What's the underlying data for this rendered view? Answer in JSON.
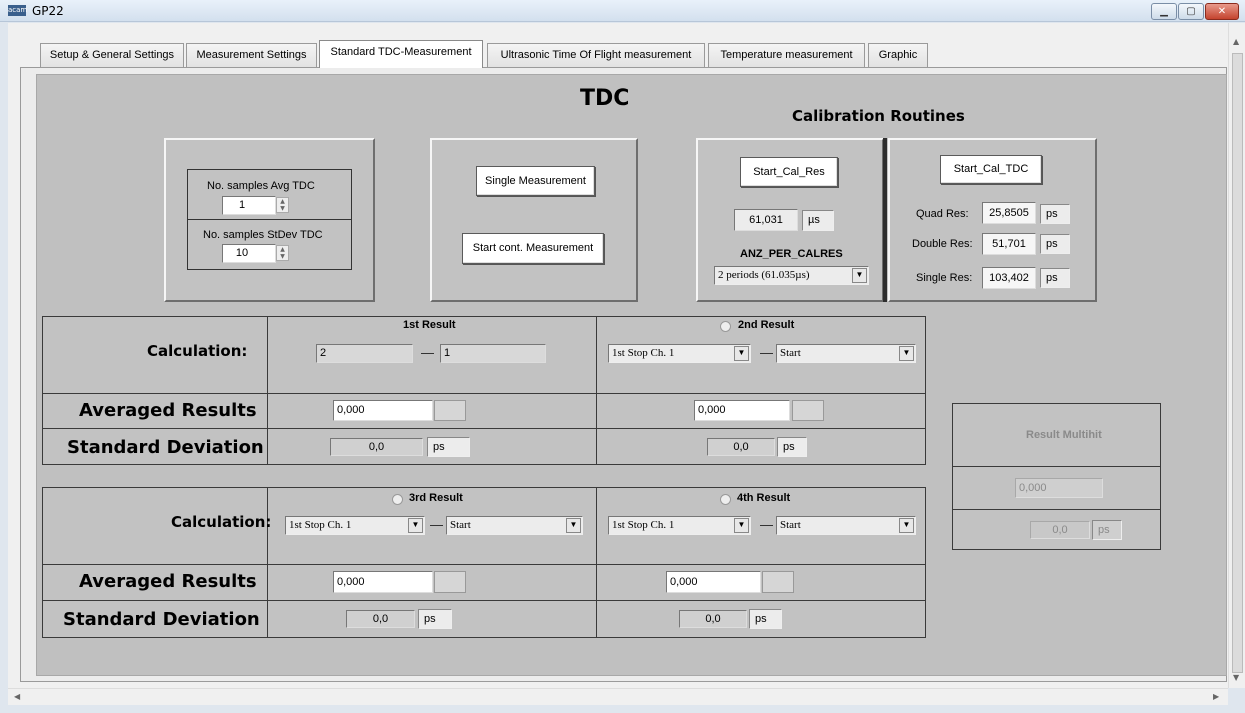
{
  "window": {
    "title": "GP22",
    "icon_text": "acam"
  },
  "tabs": [
    "Setup & General Settings",
    "Measurement Settings",
    "Standard TDC-Measurement",
    "Ultrasonic Time Of Flight measurement",
    "Temperature measurement",
    "Graphic"
  ],
  "active_tab": "Standard TDC-Measurement",
  "tdc": {
    "title": "TDC",
    "samples_avg_label": "No. samples Avg TDC",
    "samples_avg_value": "1",
    "samples_stdev_label": "No. samples StDev TDC",
    "samples_stdev_value": "10",
    "single_measurement_button": "Single Measurement",
    "start_cont_button": "Start cont. Measurement"
  },
  "calibration": {
    "title": "Calibration Routines",
    "start_cal_res_button": "Start_Cal_Res",
    "cal_res_value": "61,031",
    "cal_res_unit": "µs",
    "anz_per_calres_label": "ANZ_PER_CALRES",
    "anz_per_calres_value": "2 periods (61.035µs)",
    "start_cal_tdc_button": "Start_Cal_TDC",
    "quad_res_label": "Quad Res:",
    "quad_res_value": "25,8505",
    "double_res_label": "Double Res:",
    "double_res_value": "51,701",
    "single_res_label": "Single Res:",
    "single_res_value": "103,402",
    "unit_ps": "ps"
  },
  "results_top": {
    "calculation_label": "Calculation:",
    "averaged_label": "Averaged Results",
    "stddev_label": "Standard Deviation",
    "first": {
      "title": "1st Result",
      "field_a": "2",
      "field_b": "1",
      "avg": "0,000",
      "stddev": "0,0",
      "unit": "ps"
    },
    "second": {
      "title": "2nd Result",
      "select_a": "1st Stop Ch. 1",
      "select_b": "Start",
      "avg": "0,000",
      "stddev": "0,0",
      "unit": "ps"
    }
  },
  "results_bottom": {
    "calculation_label": "Calculation:",
    "averaged_label": "Averaged Results",
    "stddev_label": "Standard Deviation",
    "third": {
      "title": "3rd Result",
      "select_a": "1st Stop Ch. 1",
      "select_b": "Start",
      "avg": "0,000",
      "stddev": "0,0",
      "unit": "ps"
    },
    "fourth": {
      "title": "4th Result",
      "select_a": "1st Stop Ch. 1",
      "select_b": "Start",
      "avg": "0,000",
      "stddev": "0,0",
      "unit": "ps"
    }
  },
  "multihit": {
    "title": "Result Multihit",
    "avg": "0,000",
    "stddev": "0,0",
    "unit": "ps"
  }
}
